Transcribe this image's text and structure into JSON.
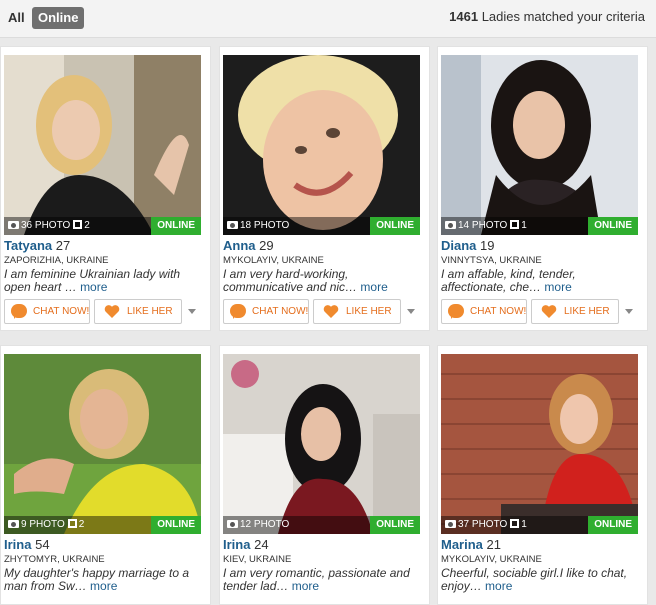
{
  "filters": {
    "all": "All",
    "online": "Online"
  },
  "summary": {
    "count": "1461",
    "label": "Ladies matched your criteria"
  },
  "labels": {
    "chat": "CHAT NOW!",
    "like": "LIKE HER",
    "online": "ONLINE",
    "more": "more",
    "photo_suffix": " PHOTO"
  },
  "colors": {
    "online_badge": "#2fae2f",
    "name_link": "#1f5e8c",
    "button_text": "#e46d1c",
    "icon": "#f08a2e"
  },
  "ladies": [
    {
      "name": "Tatyana",
      "age": "27",
      "location": "ZAPORIZHIA, UKRAINE",
      "photos": "36",
      "videos": "2",
      "online": true,
      "desc": "I am feminine Ukrainian lady with open heart …"
    },
    {
      "name": "Anna",
      "age": "29",
      "location": "MYKOLAYIV, UKRAINE",
      "photos": "18",
      "videos": "",
      "online": true,
      "desc": "I am very hard-working, communicative and nic…"
    },
    {
      "name": "Diana",
      "age": "19",
      "location": "VINNYTSYA, UKRAINE",
      "photos": "14",
      "videos": "1",
      "online": true,
      "desc": "I am affable, kind, tender, affectionate, che…"
    },
    {
      "name": "Irina",
      "age": "54",
      "location": "ZHYTOMYR, UKRAINE",
      "photos": "9",
      "videos": "2",
      "online": true,
      "desc": "My daughter's happy marriage to a man from Sw…"
    },
    {
      "name": "Irina",
      "age": "24",
      "location": "KIEV, UKRAINE",
      "photos": "12",
      "videos": "",
      "online": true,
      "desc": "I am very romantic, passionate and tender lad…"
    },
    {
      "name": "Marina",
      "age": "21",
      "location": "MYKOLAYIV, UKRAINE",
      "photos": "37",
      "videos": "1",
      "online": true,
      "desc": "Cheerful, sociable girl.I like to chat, enjoy…"
    }
  ]
}
